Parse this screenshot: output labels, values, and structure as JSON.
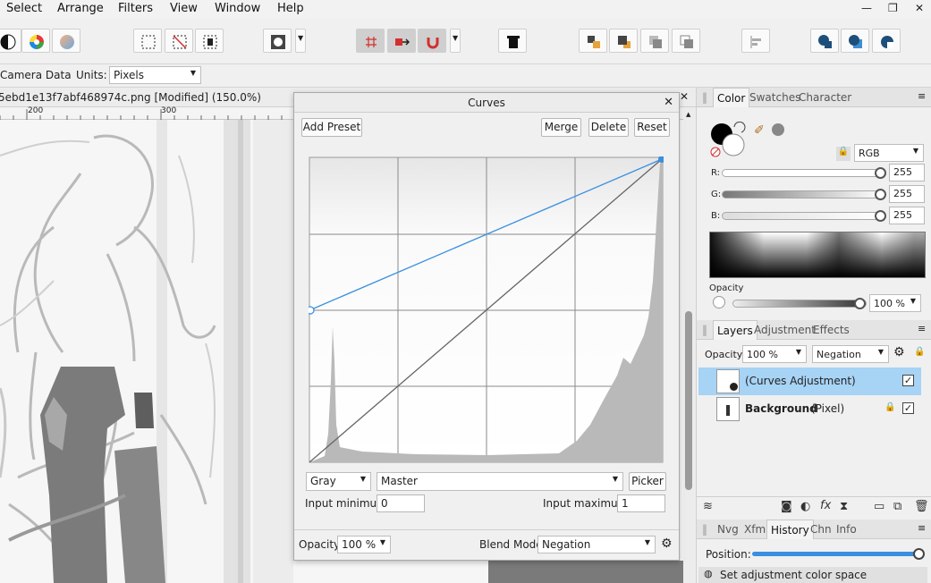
{
  "menubar": {
    "items": [
      "Select",
      "Arrange",
      "Filters",
      "View",
      "Window",
      "Help"
    ],
    "window_controls": [
      "—",
      "❐",
      "✕"
    ]
  },
  "context": {
    "camera_label": "Camera Data",
    "units_label": "Units:",
    "units_value": "Pixels"
  },
  "document": {
    "tab_title": "5ebd1e13f7abf468974c.png [Modified] (150.0%)",
    "close": "✕",
    "ruler_labels": [
      "200",
      "300"
    ]
  },
  "curves": {
    "title": "Curves",
    "close": "✕",
    "add_preset": "Add Preset",
    "merge": "Merge",
    "delete": "Delete",
    "reset": "Reset",
    "channel_mode": "Gray",
    "channel": "Master",
    "picker": "Picker",
    "input_min_label": "Input minimum:",
    "input_min_value": "0",
    "input_max_label": "Input maximum:",
    "input_max_value": "1",
    "opacity_label": "Opacity:",
    "opacity_value": "100 %",
    "blend_label": "Blend Mode:",
    "blend_value": "Negation",
    "curve_line_color": "#3a8fe0"
  },
  "color_panel": {
    "tabs": [
      "Color",
      "Swatches",
      "Character"
    ],
    "model": "RGB",
    "r_label": "R:",
    "r_value": "255",
    "g_label": "G:",
    "g_value": "255",
    "b_label": "B:",
    "b_value": "255",
    "opacity_label": "Opacity",
    "opacity_value": "100 %"
  },
  "layers_panel": {
    "tabs": [
      "Layers",
      "Adjustment",
      "Effects"
    ],
    "opacity_label": "Opacity:",
    "opacity_value": "100 %",
    "blend_value": "Negation",
    "layers": [
      {
        "name": "(Curves Adjustment)",
        "type": "",
        "selected": true,
        "visible": true
      },
      {
        "name": "Background",
        "type": "(Pixel)",
        "selected": false,
        "visible": true
      }
    ],
    "selection_color": "#a7d3f5"
  },
  "history_panel": {
    "tabs": [
      "Nvg",
      "Xfm",
      "History",
      "Chn",
      "Info"
    ],
    "position_label": "Position:",
    "last_entry": "Set adjustment color space"
  }
}
